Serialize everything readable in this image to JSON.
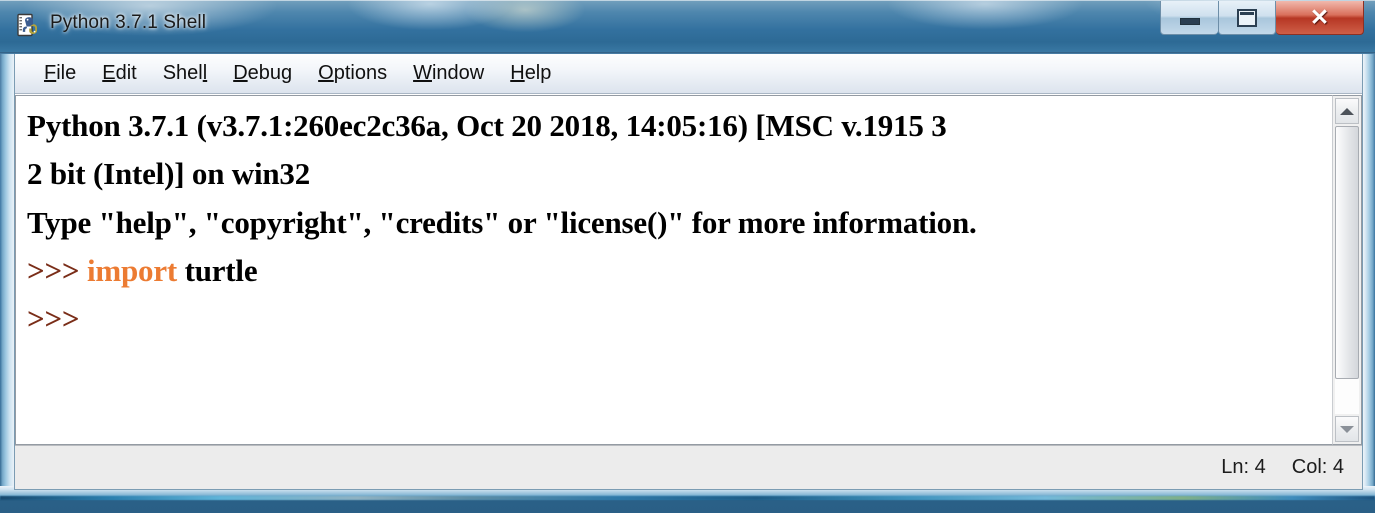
{
  "window": {
    "title": "Python 3.7.1 Shell",
    "icon": "python-idle-icon",
    "caption_buttons": {
      "minimize_label": "–",
      "maximize_label": "❐",
      "close_label": "✕"
    }
  },
  "menubar": {
    "items": [
      {
        "label": "File",
        "accel_index": 0
      },
      {
        "label": "Edit",
        "accel_index": 0
      },
      {
        "label": "Shell",
        "accel_index": 4
      },
      {
        "label": "Debug",
        "accel_index": 0
      },
      {
        "label": "Options",
        "accel_index": 0
      },
      {
        "label": "Window",
        "accel_index": 0
      },
      {
        "label": "Help",
        "accel_index": 0
      }
    ]
  },
  "shell": {
    "lines": [
      {
        "segments": [
          {
            "text": "Python 3.7.1 (v3.7.1:260ec2c36a, Oct 20 2018, 14:05:16) [MSC v.1915 3",
            "style": "output"
          }
        ]
      },
      {
        "segments": [
          {
            "text": "2 bit (Intel)] on win32",
            "style": "output"
          }
        ]
      },
      {
        "segments": [
          {
            "text": "Type \"help\", \"copyright\", \"credits\" or \"license()\" for more information.",
            "style": "output"
          }
        ]
      },
      {
        "segments": [
          {
            "text": ">>> ",
            "style": "prompt"
          },
          {
            "text": "import",
            "style": "keyword"
          },
          {
            "text": " turtle",
            "style": "output"
          }
        ]
      },
      {
        "segments": [
          {
            "text": ">>> ",
            "style": "prompt"
          }
        ]
      }
    ],
    "colors": {
      "prompt": "#7a2d18",
      "keyword": "#ec7b32",
      "output": "#000000",
      "background": "#ffffff"
    }
  },
  "scrollbar": {
    "up_arrow": "scroll-up-arrow",
    "down_arrow": "scroll-down-arrow",
    "thumb_percent": 88
  },
  "statusbar": {
    "line": "Ln: 4",
    "column": "Col: 4"
  }
}
